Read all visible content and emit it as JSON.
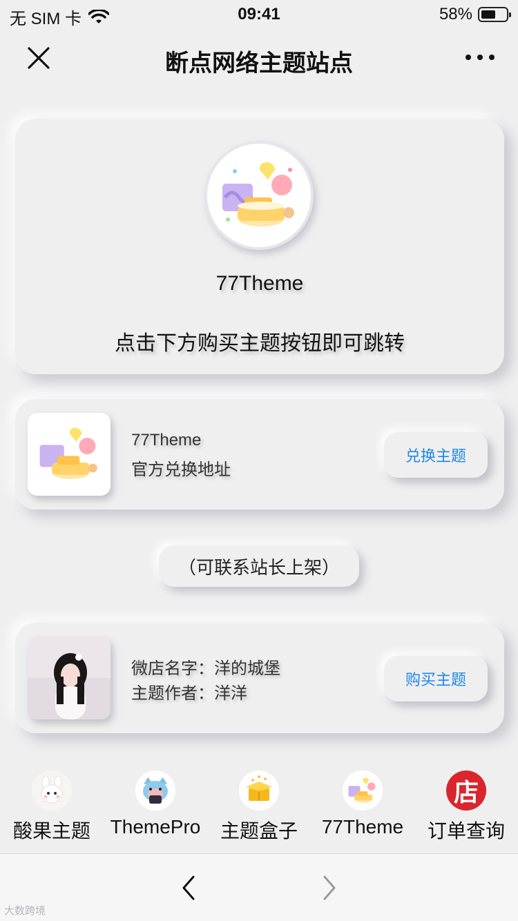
{
  "status_bar": {
    "carrier": "无 SIM 卡",
    "time": "09:41",
    "battery": "58%",
    "battery_level": 0.58
  },
  "nav": {
    "title": "断点网络主题站点",
    "close_icon": "close-icon",
    "more_icon": "more-icon"
  },
  "hero": {
    "name": "77Theme",
    "hint": "点击下方购买主题按钮即可跳转"
  },
  "exchange_card": {
    "line1": "77Theme",
    "line2": "官方兑换地址",
    "button": "兑换主题"
  },
  "contact_pill": "（可联系站长上架）",
  "shop_card": {
    "line1": "微店名字：洋的城堡",
    "line2": "主题作者：洋洋",
    "button": "购买主题"
  },
  "shortcuts": [
    {
      "label": "酸果主题",
      "icon": "bunny-icon"
    },
    {
      "label": "ThemePro",
      "icon": "cat-icon"
    },
    {
      "label": "主题盒子",
      "icon": "gift-box-icon"
    },
    {
      "label": "77Theme",
      "icon": "cake-icon"
    },
    {
      "label": "订单查询",
      "icon": "shop-icon",
      "glyph": "店",
      "color": "#d9262c"
    }
  ],
  "bottom_bar": {
    "back_icon": "chevron-left-icon",
    "forward_icon": "chevron-right-icon"
  },
  "watermark": "大数跨境"
}
